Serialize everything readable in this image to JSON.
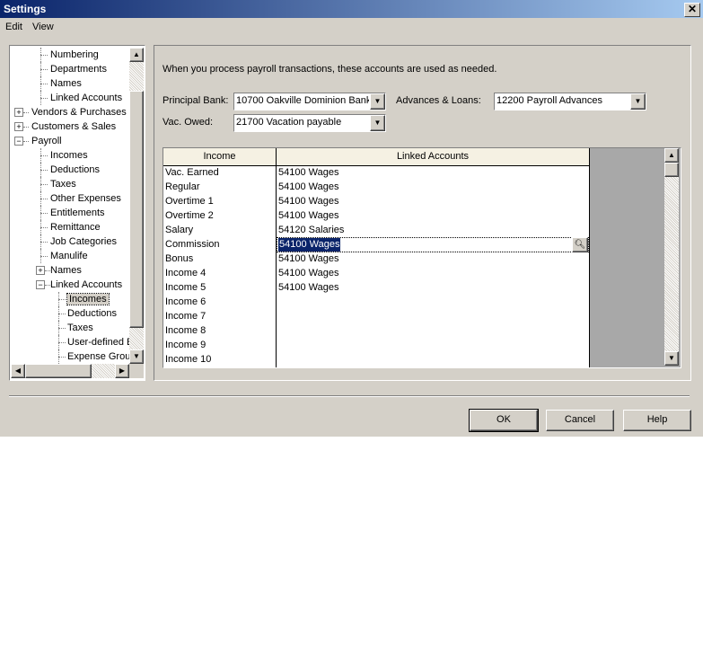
{
  "window": {
    "title": "Settings",
    "close_glyph": "✕"
  },
  "menu": [
    {
      "label": "Edit"
    },
    {
      "label": "View"
    }
  ],
  "tree": {
    "items": [
      {
        "label": "Numbering",
        "depth": 2
      },
      {
        "label": "Departments",
        "depth": 2
      },
      {
        "label": "Names",
        "depth": 2
      },
      {
        "label": "Linked Accounts",
        "depth": 2
      },
      {
        "label": "Vendors & Purchases",
        "depth": 1,
        "toggle": "+"
      },
      {
        "label": "Customers & Sales",
        "depth": 1,
        "toggle": "+"
      },
      {
        "label": "Payroll",
        "depth": 1,
        "toggle": "-"
      },
      {
        "label": "Incomes",
        "depth": 2
      },
      {
        "label": "Deductions",
        "depth": 2
      },
      {
        "label": "Taxes",
        "depth": 2
      },
      {
        "label": "Other Expenses",
        "depth": 2
      },
      {
        "label": "Entitlements",
        "depth": 2
      },
      {
        "label": "Remittance",
        "depth": 2
      },
      {
        "label": "Job Categories",
        "depth": 2
      },
      {
        "label": "Manulife",
        "depth": 2
      },
      {
        "label": "Names",
        "depth": 2,
        "toggle": "+"
      },
      {
        "label": "Linked Accounts",
        "depth": 2,
        "toggle": "-"
      },
      {
        "label": "Incomes",
        "depth": 3,
        "selected": true
      },
      {
        "label": "Deductions",
        "depth": 3
      },
      {
        "label": "Taxes",
        "depth": 3
      },
      {
        "label": "User-defined E",
        "depth": 3
      },
      {
        "label": "Expense Grou",
        "depth": 3
      }
    ]
  },
  "panel": {
    "intro": "When you process payroll transactions, these accounts are used as needed.",
    "principal_bank_label": "Principal Bank:",
    "principal_bank_value": "10700 Oakville Dominion Bank:",
    "advances_label": "Advances & Loans:",
    "advances_value": "12200 Payroll Advances",
    "vac_owed_label": "Vac. Owed:",
    "vac_owed_value": "21700 Vacation payable"
  },
  "grid": {
    "headers": [
      "Income",
      "Linked Accounts"
    ],
    "rows": [
      {
        "income": "Vac. Earned",
        "account": "54100 Wages"
      },
      {
        "income": "Regular",
        "account": "54100 Wages"
      },
      {
        "income": "Overtime 1",
        "account": "54100 Wages"
      },
      {
        "income": "Overtime 2",
        "account": "54100 Wages"
      },
      {
        "income": "Salary",
        "account": "54120 Salaries"
      },
      {
        "income": "Commission",
        "account": "54100 Wages",
        "selected": true
      },
      {
        "income": "Bonus",
        "account": "54100 Wages"
      },
      {
        "income": "Income 4",
        "account": "54100 Wages"
      },
      {
        "income": "Income 5",
        "account": "54100 Wages"
      },
      {
        "income": "Income 6",
        "account": ""
      },
      {
        "income": "Income 7",
        "account": ""
      },
      {
        "income": "Income 8",
        "account": ""
      },
      {
        "income": "Income 9",
        "account": ""
      },
      {
        "income": "Income 10",
        "account": ""
      }
    ]
  },
  "buttons": {
    "ok": "OK",
    "cancel": "Cancel",
    "help": "Help"
  },
  "colors": {
    "title_start": "#0a246a",
    "title_end": "#a6caf0",
    "face": "#d4d0c8",
    "selection": "#0a246a",
    "header": "#f5f1e3"
  }
}
